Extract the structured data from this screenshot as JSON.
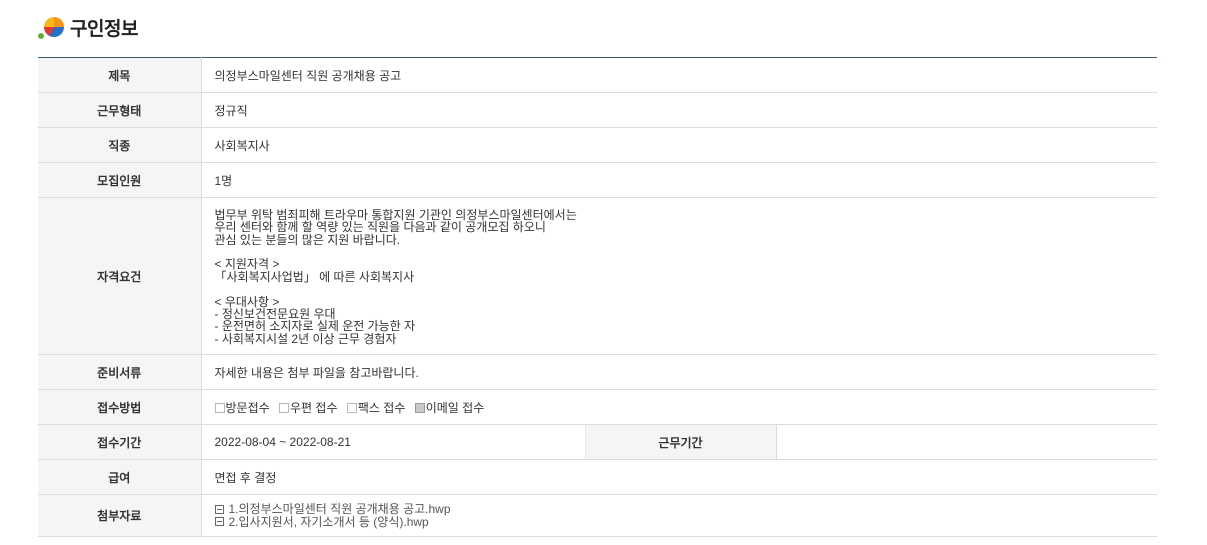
{
  "page": {
    "title": "구인정보"
  },
  "rows": {
    "title": {
      "label": "제목",
      "value": "의정부스마일센터 직원 공개채용 공고"
    },
    "work_type": {
      "label": "근무형태",
      "value": "정규직"
    },
    "job_type": {
      "label": "직종",
      "value": "사회복지사"
    },
    "headcount": {
      "label": "모집인원",
      "value": "1명"
    },
    "qualification": {
      "label": "자격요건",
      "value": "법무부 위탁 범죄피해 트라우마 통합지원 기관인 의정부스마일센터에서는\n우리 센터와 함께 할 역량 있는 직원을 다음과 같이 공개모집 하오니\n관심 있는 분들의 많은 지원 바랍니다.\n\n< 지원자격 >\n「사회복지사업법」 에 따른 사회복지사\n\n< 우대사항 >\n- 정신보건전문요원 우대\n- 운전면허 소지자로 실제 운전 가능한 자\n- 사회복지시설 2년 이상 근무 경험자"
    },
    "documents": {
      "label": "준비서류",
      "value": "자세한 내용은 첨부 파일을 참고바랍니다."
    },
    "method": {
      "label": "접수방법",
      "options": [
        {
          "label": "방문접수",
          "checked": false
        },
        {
          "label": "우편 접수",
          "checked": false
        },
        {
          "label": "팩스 접수",
          "checked": false
        },
        {
          "label": "이메일 접수",
          "checked": true
        }
      ]
    },
    "period": {
      "label": "접수기간",
      "value": "2022-08-04 ~ 2022-08-21",
      "work_label": "근무기간",
      "work_value": ""
    },
    "salary": {
      "label": "급여",
      "value": "면접 후 결정"
    },
    "attachments": {
      "label": "첨부자료",
      "files": [
        "1.의정부스마일센터 직원 공개채용 공고.hwp",
        "2.입사지원서, 자기소개서 등 (양식).hwp"
      ]
    }
  }
}
